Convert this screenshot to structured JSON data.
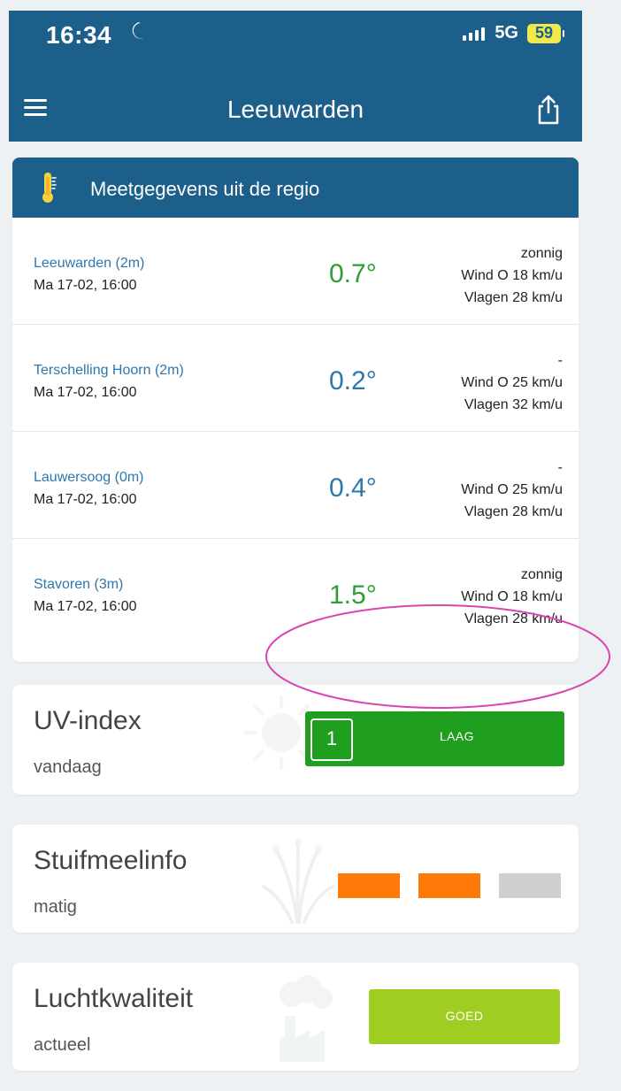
{
  "status_bar": {
    "time": "16:34",
    "network": "5G",
    "battery": "59"
  },
  "header": {
    "title": "Leeuwarden"
  },
  "measurements_card": {
    "title": "Meetgegevens uit de regio"
  },
  "stations": [
    {
      "name": "Leeuwarden (2m)",
      "date": "Ma 17-02, 16:00",
      "temperature": "0.7°",
      "temperature_color": "#2e9e34",
      "condition": "zonnig",
      "wind": "Wind O 18 km/u",
      "gusts": "Vlagen 28 km/u"
    },
    {
      "name": "Terschelling Hoorn (2m)",
      "date": "Ma 17-02, 16:00",
      "temperature": "0.2°",
      "temperature_color": "#2d77ad",
      "condition": "-",
      "wind": "Wind O 25 km/u",
      "gusts": "Vlagen 32 km/u"
    },
    {
      "name": "Lauwersoog (0m)",
      "date": "Ma 17-02, 16:00",
      "temperature": "0.4°",
      "temperature_color": "#2d77ad",
      "condition": "-",
      "wind": "Wind O 25 km/u",
      "gusts": "Vlagen 28 km/u"
    },
    {
      "name": "Stavoren (3m)",
      "date": "Ma 17-02, 16:00",
      "temperature": "1.5°",
      "temperature_color": "#2e9e34",
      "condition": "zonnig",
      "wind": "Wind O 18 km/u",
      "gusts": "Vlagen 28 km/u"
    }
  ],
  "uv": {
    "title": "UV-index",
    "subtitle": "vandaag",
    "value": "1",
    "level": "LAAG",
    "bar_color": "#1f9e20",
    "icon": "sun-icon"
  },
  "pollen": {
    "title": "Stuifmeelinfo",
    "subtitle": "matig",
    "levels": [
      {
        "color": "#ff7a08"
      },
      {
        "color": "#ff7a08"
      },
      {
        "color": "#cfcfcf"
      }
    ],
    "icon": "grass-icon"
  },
  "air_quality": {
    "title": "Luchtkwaliteit",
    "subtitle": "actueel",
    "level": "GOED",
    "bar_color": "#9fcd21",
    "icon": "factory-icon"
  },
  "colors": {
    "header": "#1c5f8b",
    "background": "#eef1f4",
    "accent_blue": "#2d77ad",
    "annotation": "#d946b0"
  }
}
